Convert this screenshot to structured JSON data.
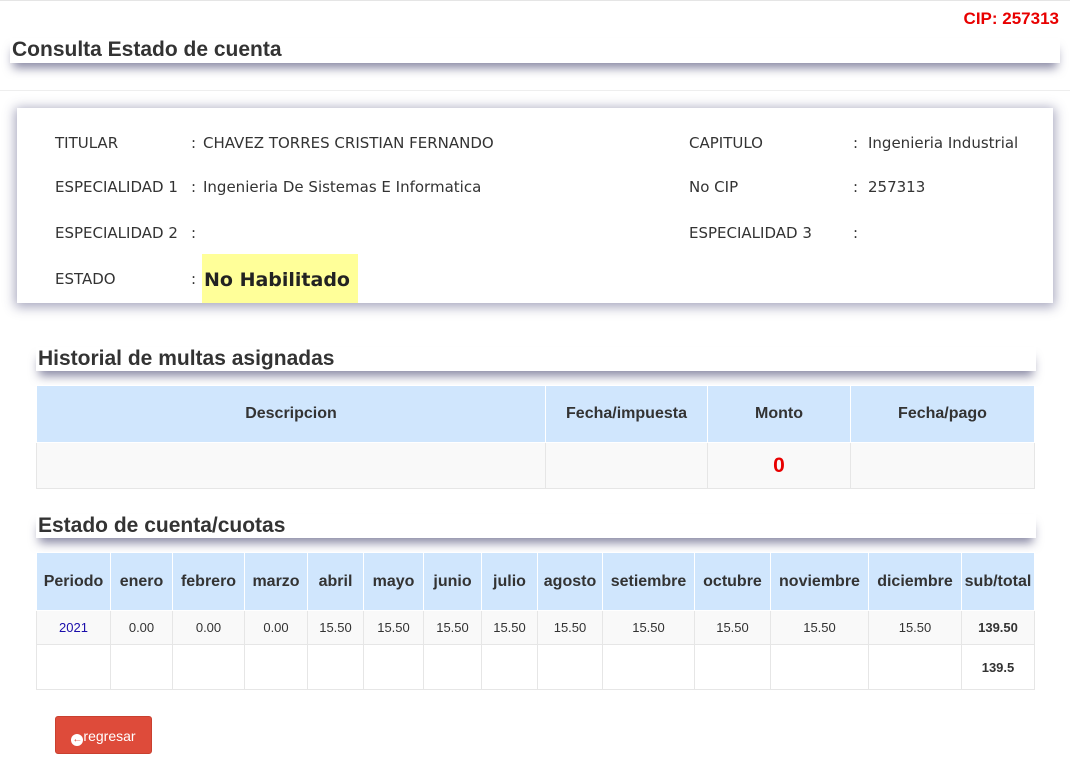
{
  "header": {
    "cip_badge": "CIP: 257313",
    "page_title": "Consulta Estado de cuenta"
  },
  "info": {
    "titular_label": "TITULAR",
    "titular_value": "CHAVEZ TORRES CRISTIAN FERNANDO",
    "especialidad1_label": "ESPECIALIDAD 1",
    "especialidad1_value": "Ingenieria De Sistemas E Informatica",
    "especialidad2_label": "ESPECIALIDAD 2",
    "especialidad2_value": "",
    "estado_label": "ESTADO",
    "estado_value": "No Habilitado",
    "capitulo_label": "CAPITULO",
    "capitulo_value": "Ingenieria Industrial",
    "nocip_label": "No CIP",
    "nocip_value": "257313",
    "especialidad3_label": "ESPECIALIDAD 3",
    "especialidad3_value": "",
    "colon": ":"
  },
  "multas": {
    "title": "Historial de multas asignadas",
    "headers": [
      "Descripcion",
      "Fecha/impuesta",
      "Monto",
      "Fecha/pago"
    ],
    "rows": [
      [
        "",
        "",
        "0",
        ""
      ]
    ]
  },
  "cuotas": {
    "title": "Estado de cuenta/cuotas",
    "headers": [
      "Periodo",
      "enero",
      "febrero",
      "marzo",
      "abril",
      "mayo",
      "junio",
      "julio",
      "agosto",
      "setiembre",
      "octubre",
      "noviembre",
      "diciembre",
      "sub/total"
    ],
    "rows": [
      [
        "2021",
        "0.00",
        "0.00",
        "0.00",
        "15.50",
        "15.50",
        "15.50",
        "15.50",
        "15.50",
        "15.50",
        "15.50",
        "15.50",
        "15.50",
        "139.50"
      ]
    ],
    "total": "139.5"
  },
  "actions": {
    "back_label": "regresar",
    "back_icon": "arrow-circle-left-icon"
  },
  "colors": {
    "accent_red": "#e80000",
    "table_header_bg": "#d0e6fd",
    "estado_highlight": "#ffff99",
    "button_bg": "#de4b3a"
  }
}
